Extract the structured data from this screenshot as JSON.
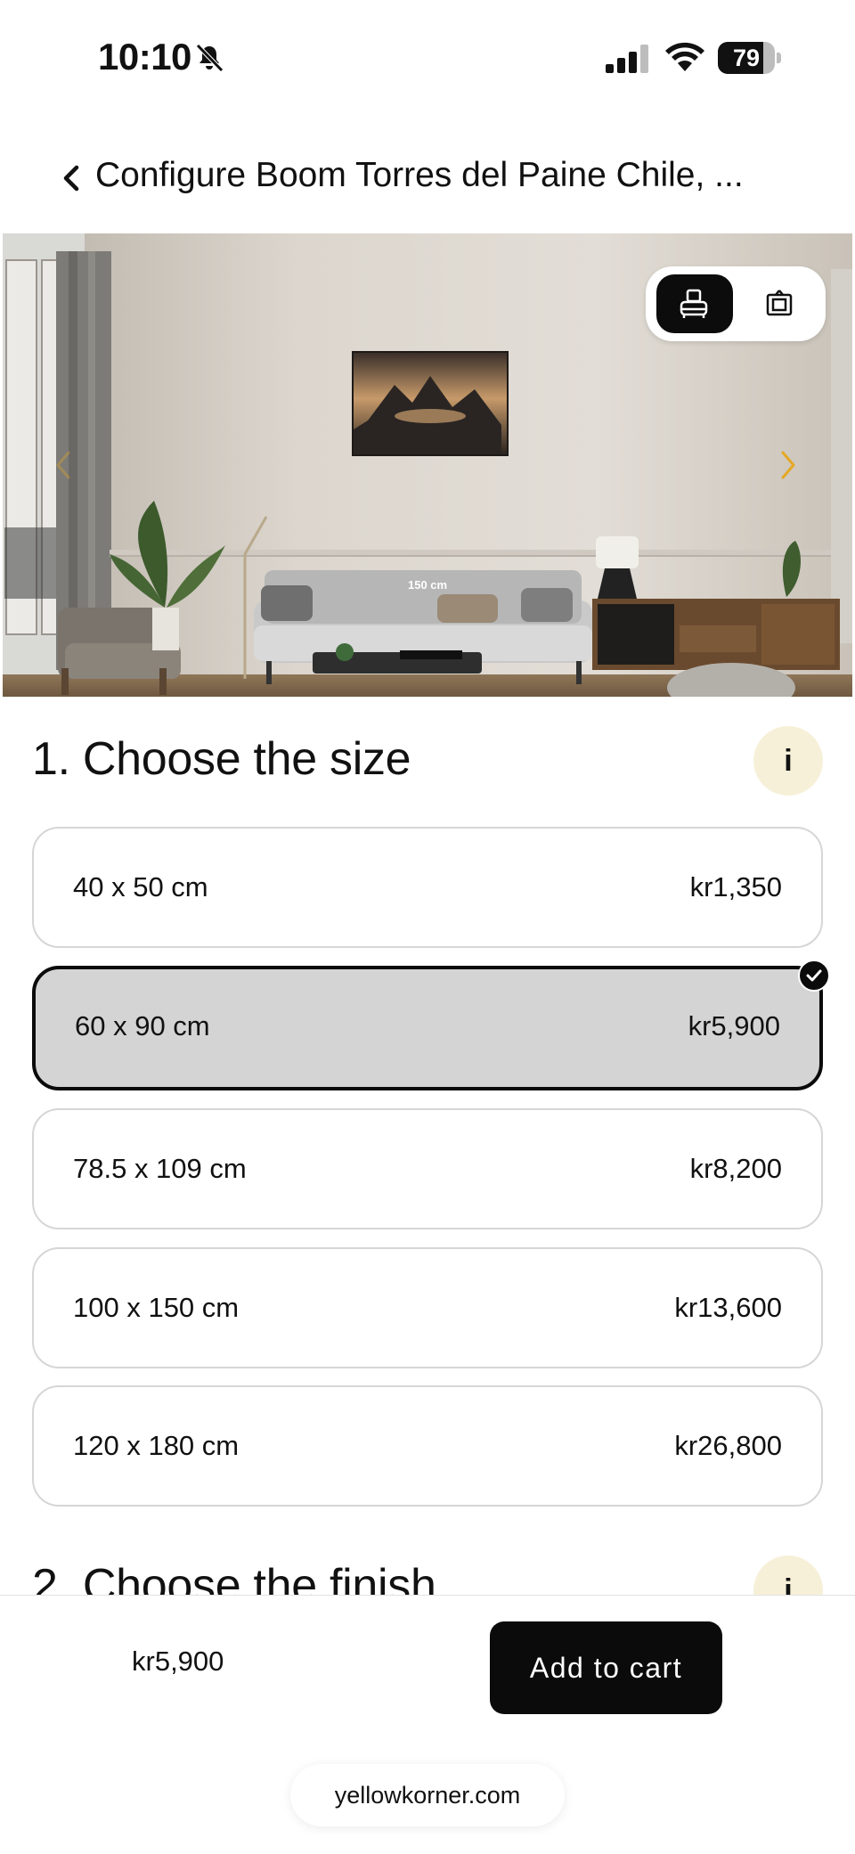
{
  "status_bar": {
    "time": "10:10",
    "battery_level": "79",
    "battery_fraction": 0.79,
    "icons": [
      "bell-slash-icon",
      "cellular-signal-icon",
      "wifi-icon",
      "battery-icon"
    ]
  },
  "header": {
    "title": "Configure Boom Torres del Paine Chile, ...",
    "back_icon": "chevron-left-icon"
  },
  "preview": {
    "size_caption": "150 cm",
    "toggle_icons": [
      "room-view-icon",
      "frame-view-icon"
    ],
    "arrow_color": "#e5a823"
  },
  "section_size": {
    "title": "1. Choose the size",
    "info_label": "i",
    "options": [
      {
        "size": "40 x 50 cm",
        "price": "kr1,350",
        "selected": false
      },
      {
        "size": "60 x 90 cm",
        "price": "kr5,900",
        "selected": true
      },
      {
        "size": "78.5 x 109 cm",
        "price": "kr8,200",
        "selected": false
      },
      {
        "size": "100 x 150 cm",
        "price": "kr13,600",
        "selected": false
      },
      {
        "size": "120 x 180 cm",
        "price": "kr26,800",
        "selected": false
      }
    ]
  },
  "section_finish": {
    "title": "2. Choose the finish",
    "info_label": "i"
  },
  "footer": {
    "total_price": "kr5,900",
    "add_to_cart_label": "Add to cart",
    "url": "yellowkorner.com"
  },
  "colors": {
    "accent_dark": "#0b0b0b",
    "selected_fill": "#d4d4d4",
    "info_fill": "#f7f0d9"
  }
}
